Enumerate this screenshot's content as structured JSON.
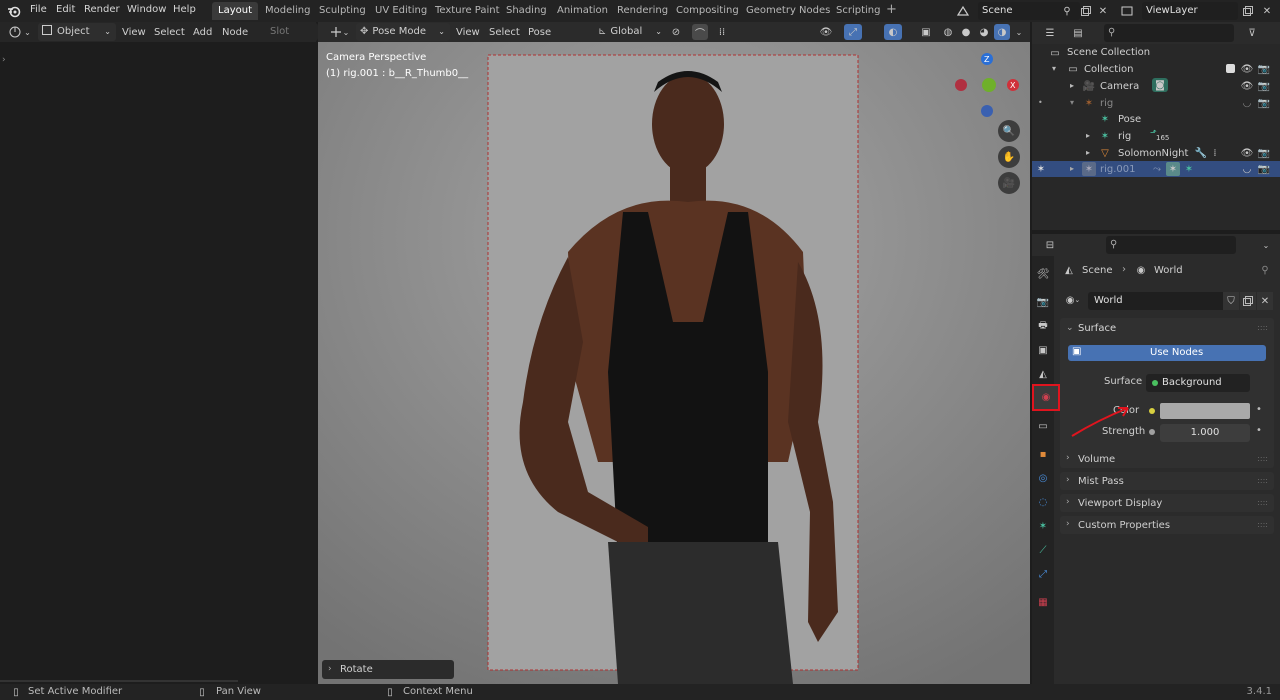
{
  "menu": {
    "file": "File",
    "edit": "Edit",
    "render": "Render",
    "window": "Window",
    "help": "Help"
  },
  "workspaces": [
    "Layout",
    "Modeling",
    "Sculpting",
    "UV Editing",
    "Texture Paint",
    "Shading",
    "Animation",
    "Rendering",
    "Compositing",
    "Geometry Nodes",
    "Scripting"
  ],
  "active_workspace": "Layout",
  "scene_field": "Scene",
  "viewlayer_field": "ViewLayer",
  "shader_header": {
    "mode": "Object",
    "view": "View",
    "select": "Select",
    "add": "Add",
    "node": "Node",
    "slot": "Slot"
  },
  "viewport_header": {
    "mode": "Pose Mode",
    "view": "View",
    "select": "Select",
    "pose": "Pose",
    "orientation": "Global"
  },
  "viewport": {
    "line1": "Camera Perspective",
    "line2": "(1) rig.001 : b__R_Thumb0__",
    "operator_panel": "Rotate"
  },
  "gizmo": {
    "z": "Z",
    "x": "X"
  },
  "outliner": {
    "scene_collection": "Scene Collection",
    "collection": "Collection",
    "items": [
      {
        "label": "Camera"
      },
      {
        "label": "rig"
      },
      {
        "label": "Pose"
      },
      {
        "label": "rig",
        "badge": "165"
      },
      {
        "label": "SolomonNight"
      },
      {
        "label": "rig.001"
      }
    ]
  },
  "properties": {
    "breadcrumb_scene": "Scene",
    "breadcrumb_world": "World",
    "world_name": "World",
    "surface_section": "Surface",
    "use_nodes": "Use Nodes",
    "surface_label": "Surface",
    "surface_value": "Background",
    "color_label": "Color",
    "strength_label": "Strength",
    "strength_value": "1.000",
    "sections": [
      "Volume",
      "Mist Pass",
      "Viewport Display",
      "Custom Properties"
    ]
  },
  "statusbar": {
    "left": "Set Active Modifier",
    "mid": "Pan View",
    "right": "Context Menu",
    "version": "3.4.1"
  },
  "colors": {
    "accent": "#4772b3",
    "annotation": "#e0141e",
    "world_color": "#a9a9a9"
  }
}
